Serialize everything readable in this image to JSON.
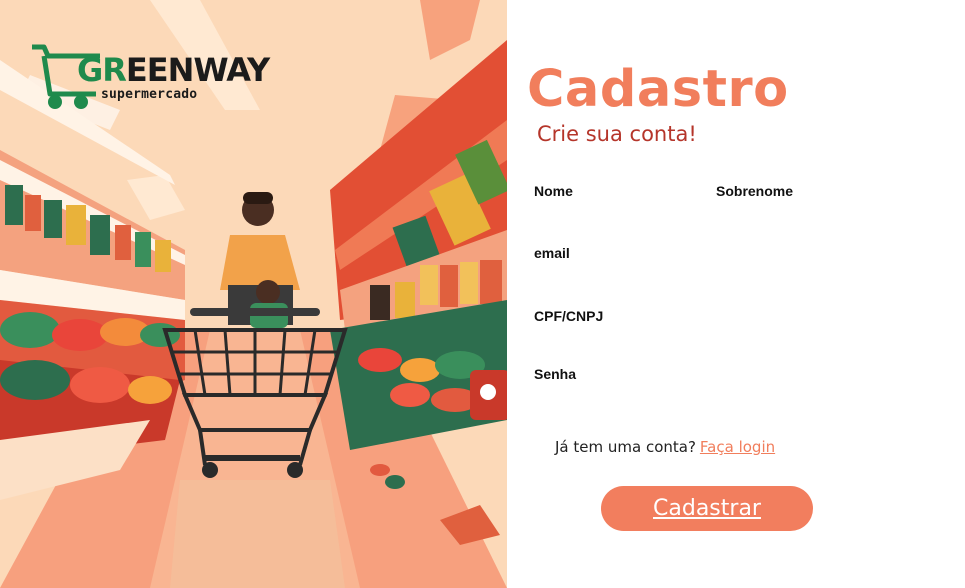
{
  "brand": {
    "logo_main": "EENWAY",
    "logo_accent": "GR",
    "logo_sub": "supermercado"
  },
  "form": {
    "title": "Cadastro",
    "subtitle": "Crie sua conta!",
    "fields": {
      "nome": {
        "label": "Nome",
        "value": ""
      },
      "sobrenome": {
        "label": "Sobrenome",
        "value": ""
      },
      "email": {
        "label": "email",
        "value": ""
      },
      "cpf": {
        "label": "CPF/CNPJ",
        "value": ""
      },
      "senha": {
        "label": "Senha",
        "value": ""
      }
    },
    "login_prompt": "Já tem uma conta?",
    "login_link": "Faça login",
    "submit_label": "Cadastrar"
  },
  "colors": {
    "accent": "#f17e5c",
    "subtitle": "#b5352a",
    "brand_green": "#1f8a4c"
  }
}
